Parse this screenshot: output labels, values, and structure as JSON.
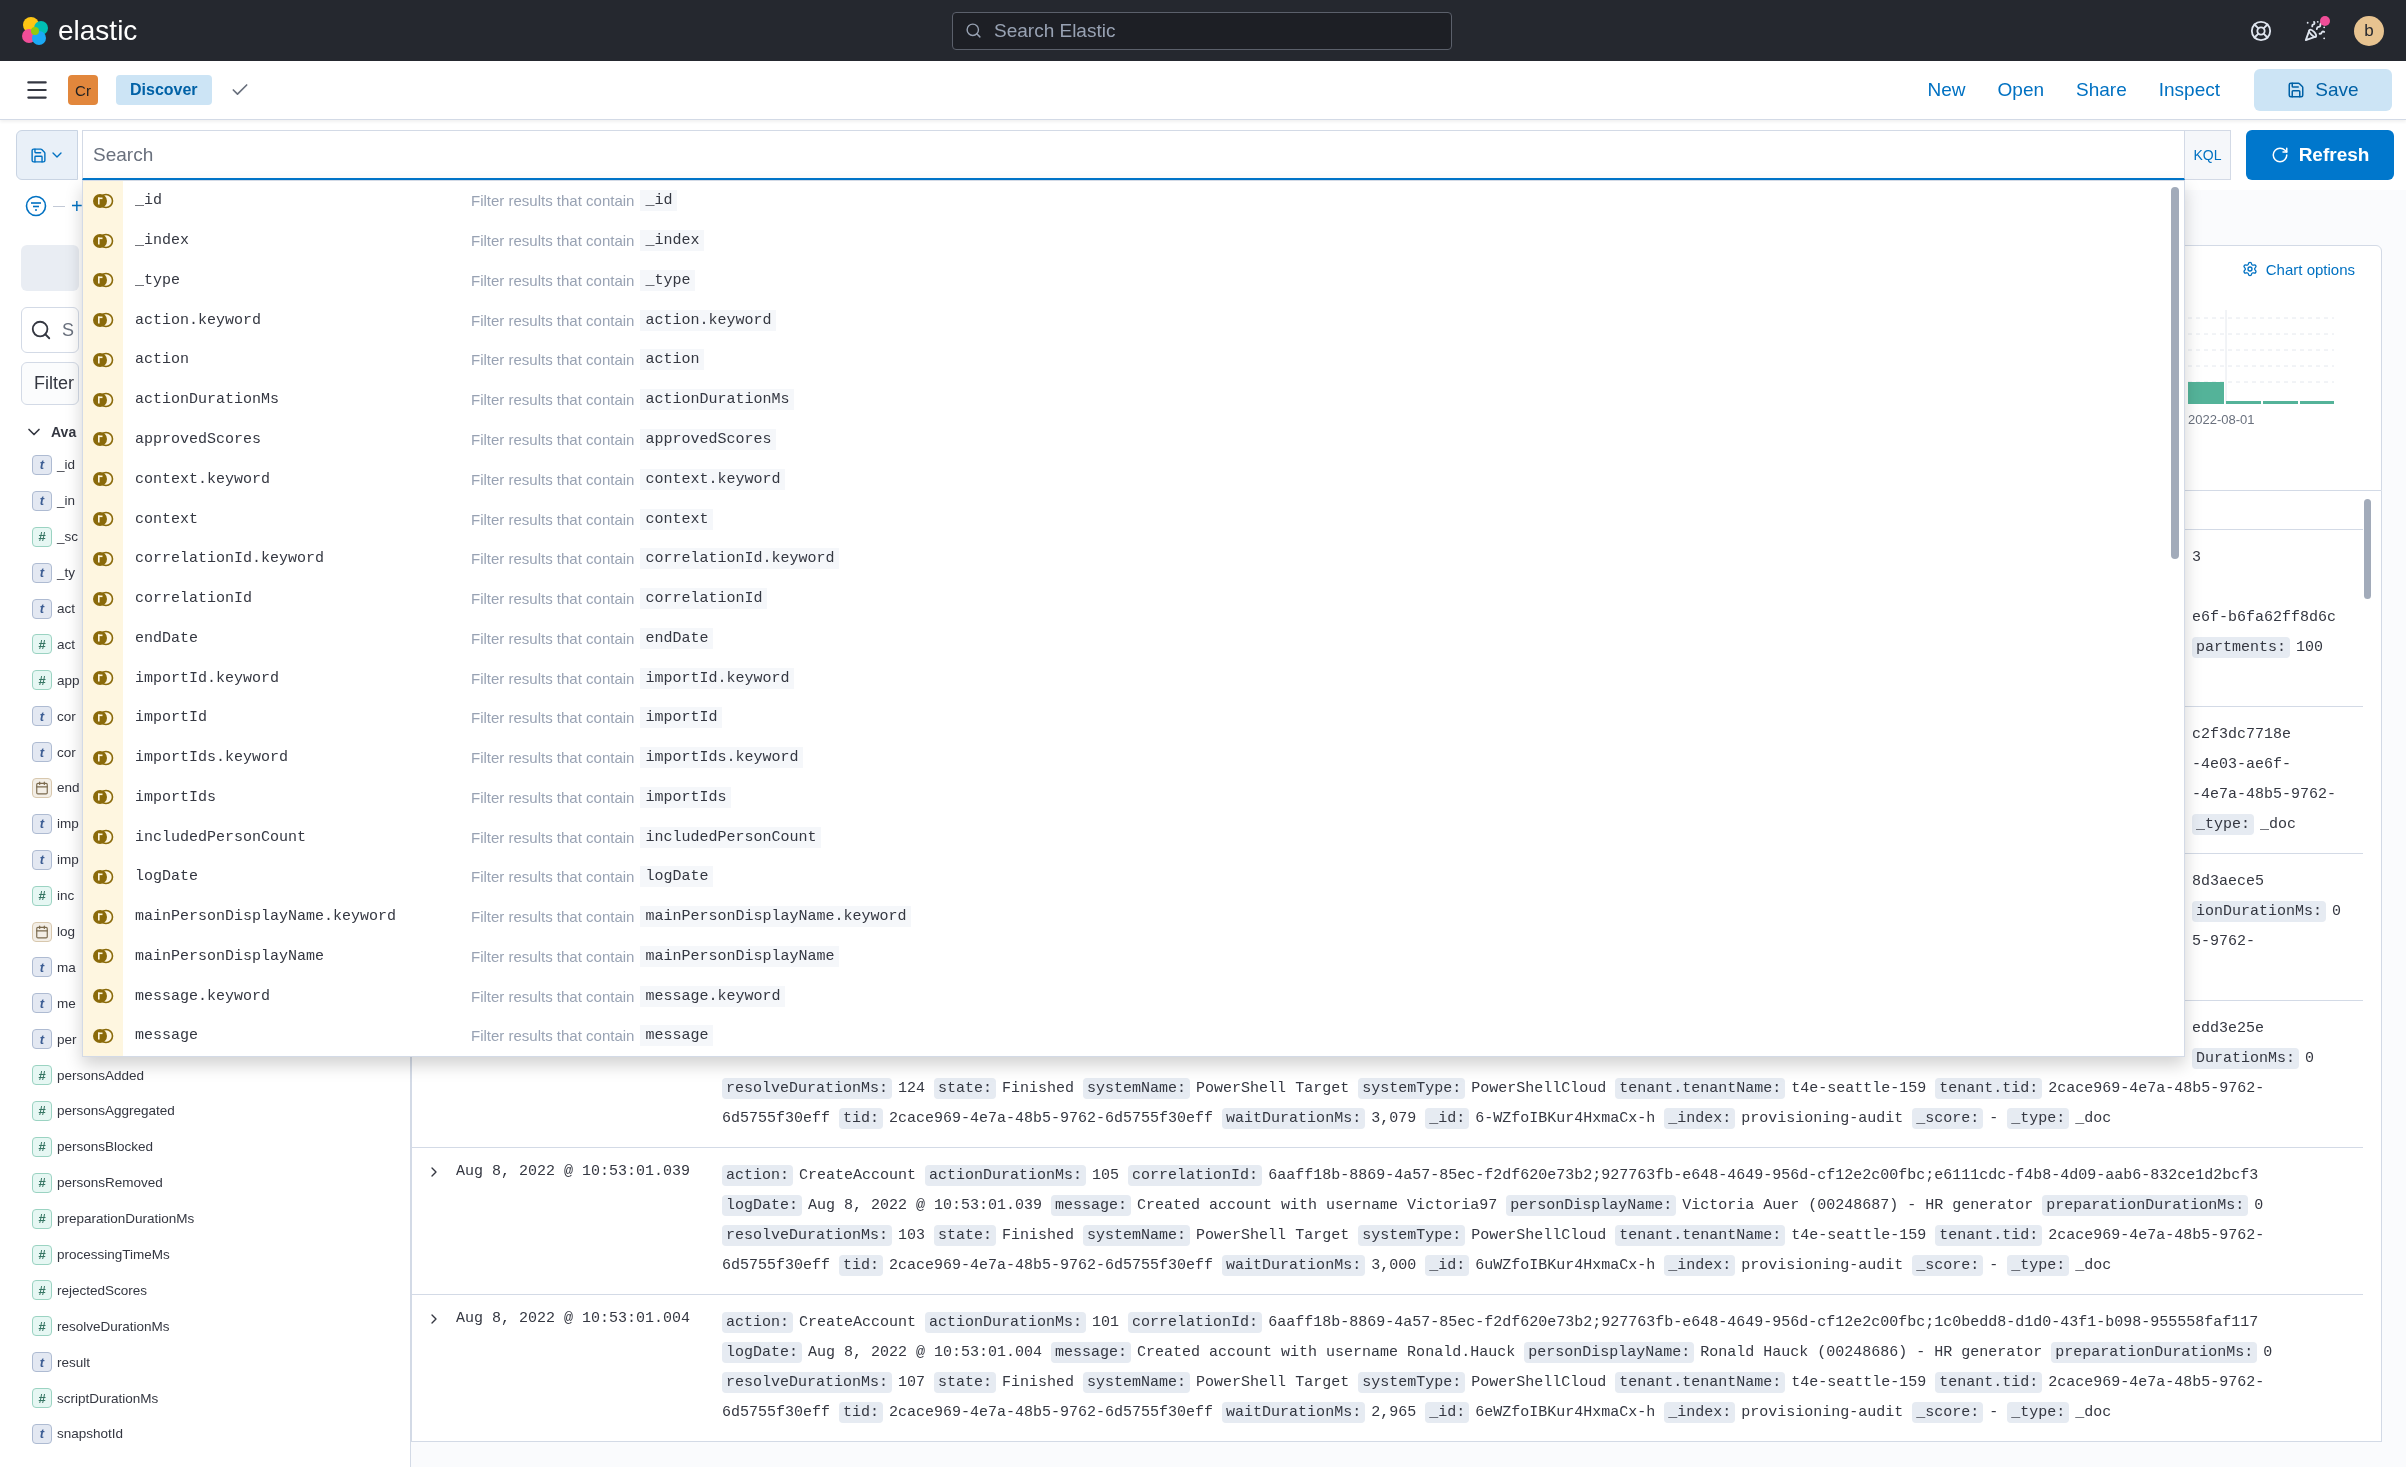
{
  "header": {
    "logo": "elastic",
    "search_placeholder": "Search Elastic",
    "has_unread": true,
    "avatar": "b"
  },
  "nav": {
    "space_badge": "Cr",
    "app": "Discover",
    "actions": [
      "New",
      "Open",
      "Share",
      "Inspect"
    ],
    "save": "Save"
  },
  "query": {
    "placeholder": "Search",
    "language": "KQL",
    "refresh": "Refresh",
    "suggestions": [
      {
        "field": "_id",
        "description": "Filter results that contain",
        "value": "_id"
      },
      {
        "field": "_index",
        "description": "Filter results that contain",
        "value": "_index"
      },
      {
        "field": "_type",
        "description": "Filter results that contain",
        "value": "_type"
      },
      {
        "field": "action.keyword",
        "description": "Filter results that contain",
        "value": "action.keyword"
      },
      {
        "field": "action",
        "description": "Filter results that contain",
        "value": "action"
      },
      {
        "field": "actionDurationMs",
        "description": "Filter results that contain",
        "value": "actionDurationMs"
      },
      {
        "field": "approvedScores",
        "description": "Filter results that contain",
        "value": "approvedScores"
      },
      {
        "field": "context.keyword",
        "description": "Filter results that contain",
        "value": "context.keyword"
      },
      {
        "field": "context",
        "description": "Filter results that contain",
        "value": "context"
      },
      {
        "field": "correlationId.keyword",
        "description": "Filter results that contain",
        "value": "correlationId.keyword"
      },
      {
        "field": "correlationId",
        "description": "Filter results that contain",
        "value": "correlationId"
      },
      {
        "field": "endDate",
        "description": "Filter results that contain",
        "value": "endDate"
      },
      {
        "field": "importId.keyword",
        "description": "Filter results that contain",
        "value": "importId.keyword"
      },
      {
        "field": "importId",
        "description": "Filter results that contain",
        "value": "importId"
      },
      {
        "field": "importIds.keyword",
        "description": "Filter results that contain",
        "value": "importIds.keyword"
      },
      {
        "field": "importIds",
        "description": "Filter results that contain",
        "value": "importIds"
      },
      {
        "field": "includedPersonCount",
        "description": "Filter results that contain",
        "value": "includedPersonCount"
      },
      {
        "field": "logDate",
        "description": "Filter results that contain",
        "value": "logDate"
      },
      {
        "field": "mainPersonDisplayName.keyword",
        "description": "Filter results that contain",
        "value": "mainPersonDisplayName.keyword"
      },
      {
        "field": "mainPersonDisplayName",
        "description": "Filter results that contain",
        "value": "mainPersonDisplayName"
      },
      {
        "field": "message.keyword",
        "description": "Filter results that contain",
        "value": "message.keyword"
      },
      {
        "field": "message",
        "description": "Filter results that contain",
        "value": "message"
      }
    ]
  },
  "sidebar": {
    "add": "+",
    "search_placeholder": "S",
    "filter": "Filter",
    "section": "Ava",
    "expanded": true,
    "fields": [
      {
        "kind": "string",
        "token": "t",
        "name": "_id"
      },
      {
        "kind": "string",
        "token": "t",
        "name": "_in"
      },
      {
        "kind": "number",
        "token": "#",
        "name": "_sc"
      },
      {
        "kind": "string",
        "token": "t",
        "name": "_ty"
      },
      {
        "kind": "string",
        "token": "t",
        "name": "act"
      },
      {
        "kind": "number",
        "token": "#",
        "name": "act"
      },
      {
        "kind": "number",
        "token": "#",
        "name": "app"
      },
      {
        "kind": "string",
        "token": "t",
        "name": "cor"
      },
      {
        "kind": "string",
        "token": "t",
        "name": "cor"
      },
      {
        "kind": "date",
        "name": "end"
      },
      {
        "kind": "string",
        "token": "t",
        "name": "imp"
      },
      {
        "kind": "string",
        "token": "t",
        "name": "imp"
      },
      {
        "kind": "number",
        "token": "#",
        "name": "inc"
      },
      {
        "kind": "date",
        "name": "log"
      },
      {
        "kind": "string",
        "token": "t",
        "name": "ma"
      },
      {
        "kind": "string",
        "token": "t",
        "name": "me"
      },
      {
        "kind": "string",
        "token": "t",
        "name": "per"
      },
      {
        "kind": "number",
        "token": "#",
        "name": "personsAdded"
      },
      {
        "kind": "number",
        "token": "#",
        "name": "personsAggregated"
      },
      {
        "kind": "number",
        "token": "#",
        "name": "personsBlocked"
      },
      {
        "kind": "number",
        "token": "#",
        "name": "personsRemoved"
      },
      {
        "kind": "number",
        "token": "#",
        "name": "preparationDurationMs"
      },
      {
        "kind": "number",
        "token": "#",
        "name": "processingTimeMs"
      },
      {
        "kind": "number",
        "token": "#",
        "name": "rejectedScores"
      },
      {
        "kind": "number",
        "token": "#",
        "name": "resolveDurationMs"
      },
      {
        "kind": "string",
        "token": "t",
        "name": "result"
      },
      {
        "kind": "number",
        "token": "#",
        "name": "scriptDurationMs"
      },
      {
        "kind": "string",
        "token": "t",
        "name": "snapshotId"
      }
    ]
  },
  "chart": {
    "options": "Chart options",
    "date_label": "2022-08-01"
  },
  "documents": [
    {
      "lines": [
        {
          "kind": "clipped",
          "pairs": [
            {
              "value": "3"
            }
          ]
        },
        {
          "kind": "covered"
        },
        {
          "kind": "clipped",
          "pairs": [
            {
              "value": "e6f-b6fa62ff8d6c"
            }
          ]
        },
        {
          "kind": "clipped",
          "pairs": [
            {
              "key": "partments:",
              "value": "100"
            }
          ]
        },
        {
          "kind": "covered"
        }
      ]
    },
    {
      "lines": [
        {
          "kind": "clipped",
          "pairs": [
            {
              "value": "c2f3dc7718e"
            }
          ]
        },
        {
          "kind": "clipped",
          "pairs": [
            {
              "value": "-4e03-ae6f-"
            }
          ]
        },
        {
          "kind": "clipped",
          "pairs": [
            {
              "value": "-4e7a-48b5-9762-"
            }
          ]
        },
        {
          "kind": "clipped",
          "pairs": [
            {
              "key": "_type:",
              "value": "_doc"
            }
          ]
        }
      ]
    },
    {
      "lines": [
        {
          "kind": "clipped",
          "pairs": [
            {
              "value": "8d3aece5"
            }
          ]
        },
        {
          "kind": "clipped",
          "pairs": [
            {
              "key": "ionDurationMs:",
              "value": "0"
            }
          ]
        },
        {
          "kind": "clipped",
          "pairs": [
            {
              "value": "5-9762-"
            }
          ]
        },
        {
          "kind": "covered"
        }
      ]
    },
    {
      "lines": [
        {
          "kind": "clipped",
          "pairs": [
            {
              "value": "edd3e25e"
            }
          ]
        },
        {
          "kind": "clipped",
          "pairs": [
            {
              "key": "DurationMs:",
              "value": "0"
            }
          ]
        },
        {
          "kind": "full",
          "pairs": [
            {
              "key": "resolveDurationMs:",
              "value": "124"
            },
            {
              "key": "state:",
              "value": "Finished"
            },
            {
              "key": "systemName:",
              "value": "PowerShell Target"
            },
            {
              "key": "systemType:",
              "value": "PowerShellCloud"
            },
            {
              "key": "tenant.tenantName:",
              "value": "t4e-seattle-159"
            },
            {
              "key": "tenant.tid:",
              "value": "2cace969-4e7a-48b5-9762-"
            }
          ]
        },
        {
          "kind": "full",
          "pairs": [
            {
              "value": "6d5755f30eff"
            },
            {
              "key": "tid:",
              "value": "2cace969-4e7a-48b5-9762-6d5755f30eff"
            },
            {
              "key": "waitDurationMs:",
              "value": "3,079"
            },
            {
              "key": "_id:",
              "value": "6-WZfoIBKur4HxmaCx-h"
            },
            {
              "key": "_index:",
              "value": "provisioning-audit"
            },
            {
              "key": "_score:",
              "value": "-"
            },
            {
              "key": "_type:",
              "value": "_doc"
            }
          ]
        }
      ]
    },
    {
      "date": "Aug 8, 2022 @ 10:53:01.039",
      "lines": [
        {
          "kind": "full",
          "pairs": [
            {
              "key": "action:",
              "value": "CreateAccount"
            },
            {
              "key": "actionDurationMs:",
              "value": "105"
            },
            {
              "key": "correlationId:",
              "value": "6aaff18b-8869-4a57-85ec-f2df620e73b2;927763fb-e648-4649-956d-cf12e2c00fbc;e6111cdc-f4b8-4d09-aab6-832ce1d2bcf3"
            }
          ]
        },
        {
          "kind": "full",
          "pairs": [
            {
              "key": "logDate:",
              "value": "Aug 8, 2022 @ 10:53:01.039"
            },
            {
              "key": "message:",
              "value": "Created account with username Victoria97"
            },
            {
              "key": "personDisplayName:",
              "value": "Victoria Auer (00248687) - HR generator"
            },
            {
              "key": "preparationDurationMs:",
              "value": "0"
            }
          ]
        },
        {
          "kind": "full",
          "pairs": [
            {
              "key": "resolveDurationMs:",
              "value": "103"
            },
            {
              "key": "state:",
              "value": "Finished"
            },
            {
              "key": "systemName:",
              "value": "PowerShell Target"
            },
            {
              "key": "systemType:",
              "value": "PowerShellCloud"
            },
            {
              "key": "tenant.tenantName:",
              "value": "t4e-seattle-159"
            },
            {
              "key": "tenant.tid:",
              "value": "2cace969-4e7a-48b5-9762-"
            }
          ]
        },
        {
          "kind": "full",
          "pairs": [
            {
              "value": "6d5755f30eff"
            },
            {
              "key": "tid:",
              "value": "2cace969-4e7a-48b5-9762-6d5755f30eff"
            },
            {
              "key": "waitDurationMs:",
              "value": "3,000"
            },
            {
              "key": "_id:",
              "value": "6uWZfoIBKur4HxmaCx-h"
            },
            {
              "key": "_index:",
              "value": "provisioning-audit"
            },
            {
              "key": "_score:",
              "value": "-"
            },
            {
              "key": "_type:",
              "value": "_doc"
            }
          ]
        }
      ]
    },
    {
      "date": "Aug 8, 2022 @ 10:53:01.004",
      "lines": [
        {
          "kind": "full",
          "pairs": [
            {
              "key": "action:",
              "value": "CreateAccount"
            },
            {
              "key": "actionDurationMs:",
              "value": "101"
            },
            {
              "key": "correlationId:",
              "value": "6aaff18b-8869-4a57-85ec-f2df620e73b2;927763fb-e648-4649-956d-cf12e2c00fbc;1c0bedd8-d1d0-43f1-b098-955558faf117"
            }
          ]
        },
        {
          "kind": "full",
          "pairs": [
            {
              "key": "logDate:",
              "value": "Aug 8, 2022 @ 10:53:01.004"
            },
            {
              "key": "message:",
              "value": "Created account with username Ronald.Hauck"
            },
            {
              "key": "personDisplayName:",
              "value": "Ronald Hauck (00248686) - HR generator"
            },
            {
              "key": "preparationDurationMs:",
              "value": "0"
            }
          ]
        },
        {
          "kind": "full",
          "pairs": [
            {
              "key": "resolveDurationMs:",
              "value": "107"
            },
            {
              "key": "state:",
              "value": "Finished"
            },
            {
              "key": "systemName:",
              "value": "PowerShell Target"
            },
            {
              "key": "systemType:",
              "value": "PowerShellCloud"
            },
            {
              "key": "tenant.tenantName:",
              "value": "t4e-seattle-159"
            },
            {
              "key": "tenant.tid:",
              "value": "2cace969-4e7a-48b5-9762-"
            }
          ]
        },
        {
          "kind": "full",
          "pairs": [
            {
              "value": "6d5755f30eff"
            },
            {
              "key": "tid:",
              "value": "2cace969-4e7a-48b5-9762-6d5755f30eff"
            },
            {
              "key": "waitDurationMs:",
              "value": "2,965"
            },
            {
              "key": "_id:",
              "value": "6eWZfoIBKur4HxmaCx-h"
            },
            {
              "key": "_index:",
              "value": "provisioning-audit"
            },
            {
              "key": "_score:",
              "value": "-"
            },
            {
              "key": "_type:",
              "value": "_doc"
            }
          ]
        }
      ]
    }
  ]
}
